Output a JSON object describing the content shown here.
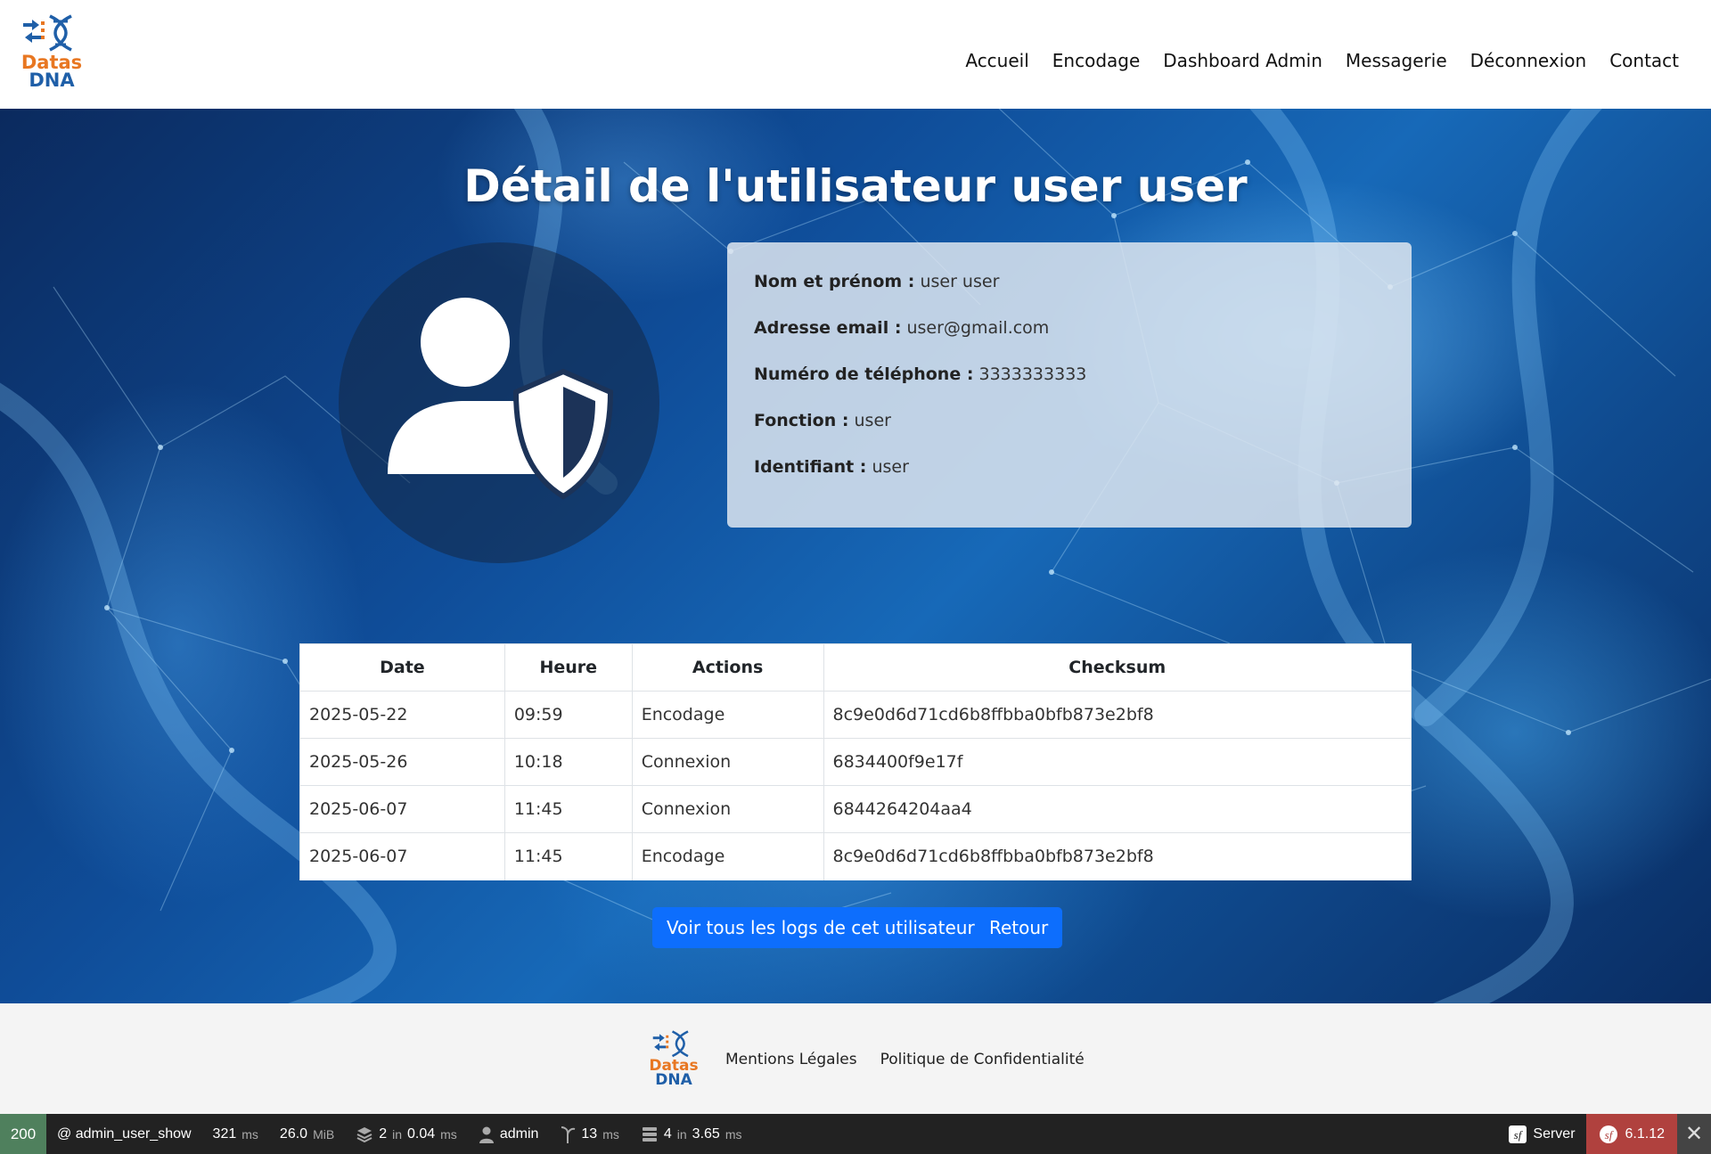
{
  "header": {
    "logo": {
      "word1": "Datas",
      "word2": "DNA"
    },
    "nav": [
      "Accueil",
      "Encodage",
      "Dashboard Admin",
      "Messagerie",
      "Déconnexion",
      "Contact"
    ]
  },
  "main": {
    "title": "Détail de l'utilisateur user user",
    "profile": [
      {
        "label": "Nom et prénom :",
        "value": "user user"
      },
      {
        "label": "Adresse email :",
        "value": "user@gmail.com"
      },
      {
        "label": "Numéro de téléphone :",
        "value": "3333333333"
      },
      {
        "label": "Fonction :",
        "value": "user"
      },
      {
        "label": "Identifiant :",
        "value": "user"
      }
    ],
    "table": {
      "columns": [
        "Date",
        "Heure",
        "Actions",
        "Checksum"
      ],
      "rows": [
        [
          "2025-05-22",
          "09:59",
          "Encodage",
          "8c9e0d6d71cd6b8ffbba0bfb873e2bf8"
        ],
        [
          "2025-05-26",
          "10:18",
          "Connexion",
          "6834400f9e17f"
        ],
        [
          "2025-06-07",
          "11:45",
          "Connexion",
          "6844264204aa4"
        ],
        [
          "2025-06-07",
          "11:45",
          "Encodage",
          "8c9e0d6d71cd6b8ffbba0bfb873e2bf8"
        ]
      ]
    },
    "buttons": {
      "logs": "Voir tous les logs de cet utilisateur",
      "back": "Retour"
    }
  },
  "footer": {
    "logo": {
      "word1": "Datas",
      "word2": "DNA"
    },
    "links": [
      "Mentions Légales",
      "Politique de Confidentialité"
    ]
  },
  "debug_toolbar": {
    "status": "200",
    "route": "@ admin_user_show",
    "time": "321",
    "time_unit": "ms",
    "memory": "26.0",
    "memory_unit": "MiB",
    "cache_count": "2",
    "cache_in": "in",
    "cache_time": "0.04",
    "cache_unit": "ms",
    "user": "admin",
    "twig_time": "13",
    "twig_unit": "ms",
    "db_count": "4",
    "db_in": "in",
    "db_time": "3.65",
    "db_unit": "ms",
    "server": "Server",
    "version": "6.1.12"
  },
  "colors": {
    "primary": "#0d6efd",
    "logo_orange": "#e87722",
    "logo_blue": "#1f5fa8",
    "status_ok": "#4f805d",
    "version_bg": "#b0413e"
  }
}
